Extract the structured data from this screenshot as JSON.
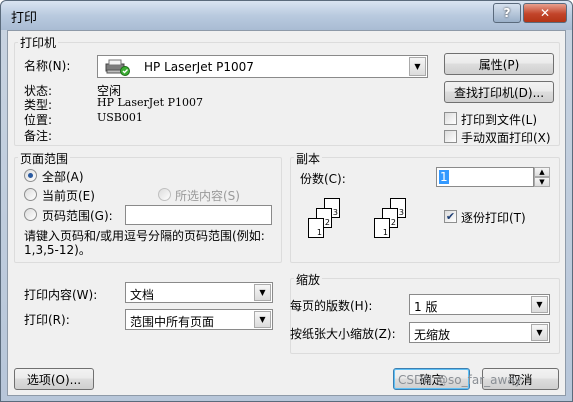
{
  "window": {
    "title": "打印",
    "help_label": "?",
    "close_label": "✕"
  },
  "printer": {
    "section_title": "打印机",
    "name_label": "名称(N):",
    "name_value": "HP LaserJet P1007",
    "status_label": "状态:",
    "status_value": "空闲",
    "type_label": "类型:",
    "type_value": "HP LaserJet P1007",
    "location_label": "位置:",
    "location_value": "USB001",
    "comment_label": "备注:",
    "properties_button": "属性(P)",
    "find_printer_button": "查找打印机(D)...",
    "print_to_file_label": "打印到文件(L)",
    "print_to_file_checked": false,
    "manual_duplex_label": "手动双面打印(X)",
    "manual_duplex_checked": false
  },
  "page_range": {
    "title": "页面范围",
    "all_label": "全部(A)",
    "current_label": "当前页(E)",
    "selection_label": "所选内容(S)",
    "pages_label": "页码范围(G):",
    "pages_value": "",
    "hint": "请键入页码和/或用逗号分隔的页码范围(例如: 1,3,5-12)。",
    "selected": "all"
  },
  "copies": {
    "title": "副本",
    "count_label": "份数(C):",
    "count_value": "1",
    "collate_label": "逐份打印(T)",
    "collate_checked": true,
    "collate_icons": [
      [
        "1",
        "2",
        "3"
      ],
      [
        "1",
        "2",
        "3"
      ]
    ]
  },
  "print_what": {
    "label": "打印内容(W):",
    "value": "文档"
  },
  "print_option": {
    "label": "打印(R):",
    "value": "范围中所有页面"
  },
  "zoom": {
    "title": "缩放",
    "pages_per_sheet_label": "每页的版数(H):",
    "pages_per_sheet_value": "1 版",
    "scale_label": "按纸张大小缩放(Z):",
    "scale_value": "无缩放"
  },
  "footer": {
    "options_button": "选项(O)...",
    "ok_button": "确定",
    "cancel_button": "取消",
    "watermark": "CSDN @so_far_away"
  }
}
